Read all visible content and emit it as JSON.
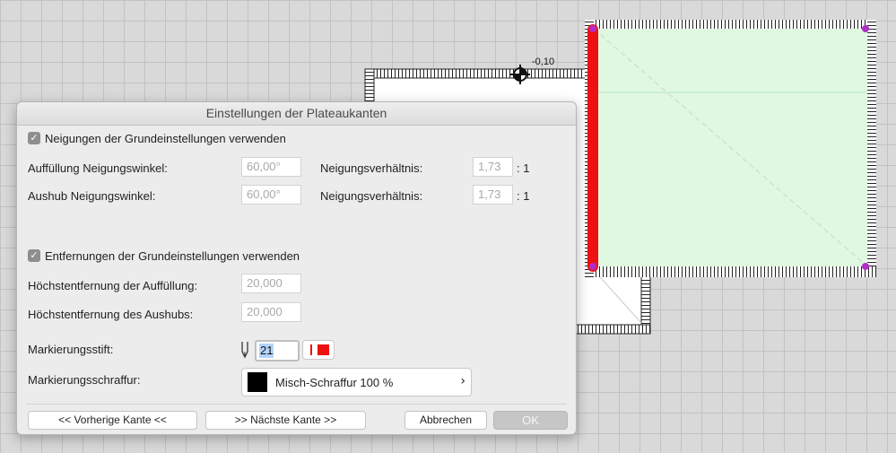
{
  "canvas": {
    "dimension_label": "-0,10",
    "edge_highlight_color": "#ee1111",
    "plateau_fill_color": "#dff8df"
  },
  "dialog": {
    "title": "Einstellungen der Plateaukanten",
    "slope_checkbox": {
      "label": "Neigungen der Grundeinstellungen verwenden",
      "checked": true
    },
    "fill_angle": {
      "label": "Auffüllung Neigungswinkel:",
      "value": "60,00°"
    },
    "fill_ratio": {
      "label": "Neigungsverhältnis:",
      "value": "1,73",
      "suffix": ": 1"
    },
    "cut_angle": {
      "label": "Aushub Neigungswinkel:",
      "value": "60,00°"
    },
    "cut_ratio": {
      "label": "Neigungsverhältnis:",
      "value": "1,73",
      "suffix": ": 1"
    },
    "distance_checkbox": {
      "label": "Entfernungen der Grundeinstellungen verwenden",
      "checked": true
    },
    "max_fill_distance": {
      "label": "Höchstentfernung der Auffüllung:",
      "value": "20,000"
    },
    "max_cut_distance": {
      "label": "Höchstentfernung des Aushubs:",
      "value": "20,000"
    },
    "marker_pen": {
      "label": "Markierungsstift:",
      "value": "21",
      "pen_color": "#ee1111"
    },
    "marker_hatch": {
      "label": "Markierungsschraffur:",
      "value": "Misch-Schraffur 100 %"
    },
    "buttons": {
      "prev": "<< Vorherige Kante <<",
      "next": ">> Nächste Kante >>",
      "cancel": "Abbrechen",
      "ok": "OK"
    }
  }
}
